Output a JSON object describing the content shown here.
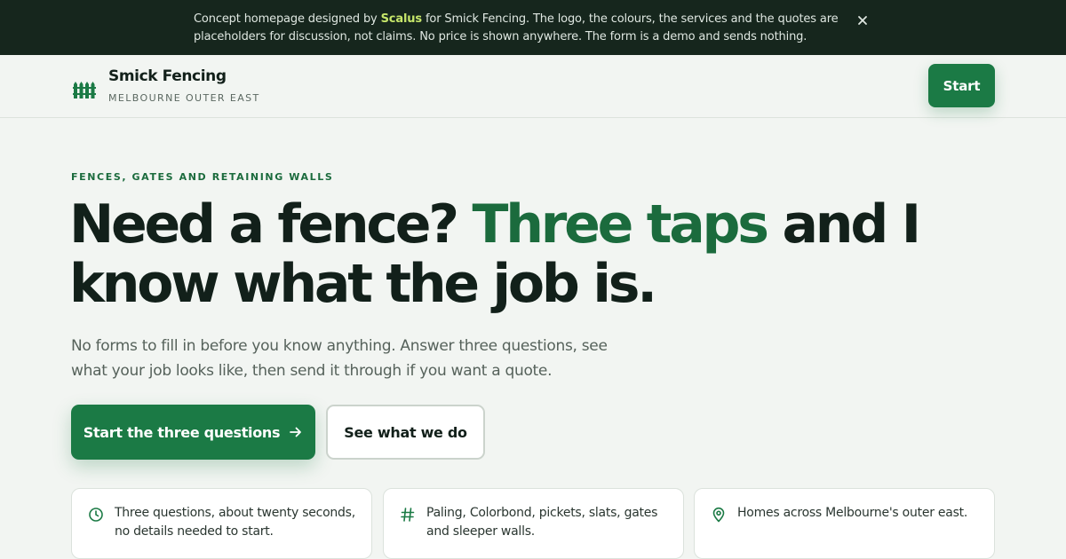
{
  "banner": {
    "text_before": "Concept homepage designed by",
    "brand": "Scalus",
    "text_after": "for Smick Fencing. The logo, the colours, the services and the quotes are placeholders for discussion, not claims. No price is shown anywhere. The form is a demo and sends nothing.",
    "close_icon": "close-icon"
  },
  "header": {
    "logo_icon": "fence-icon",
    "name": "Smick Fencing",
    "tagline": "MELBOURNE OUTER EAST",
    "start_label": "Start"
  },
  "hero": {
    "eyebrow": "FENCES, GATES AND RETAINING WALLS",
    "headline_part1": "Need a fence? ",
    "headline_accent": "Three taps",
    "headline_part2": " and I know what the job is.",
    "lede": "No forms to fill in before you know anything. Answer three questions, see what your job looks like, then send it through if you want a quote.",
    "primary_cta": "Start the three questions",
    "secondary_cta": "See what we do"
  },
  "features": [
    {
      "icon": "clock-icon",
      "text": "Three questions, about twenty seconds, no details needed to start."
    },
    {
      "icon": "hash-icon",
      "text": "Paling, Colorbond, pickets, slats, gates and sleeper walls."
    },
    {
      "icon": "map-pin-icon",
      "text": "Homes across Melbourne's outer east."
    }
  ],
  "colors": {
    "accent": "#1b7a45",
    "accent_text": "#1b6b3d",
    "banner_bg": "#16261d",
    "brand_highlight": "#c6e66a",
    "page_bg": "#f2f5f2"
  }
}
